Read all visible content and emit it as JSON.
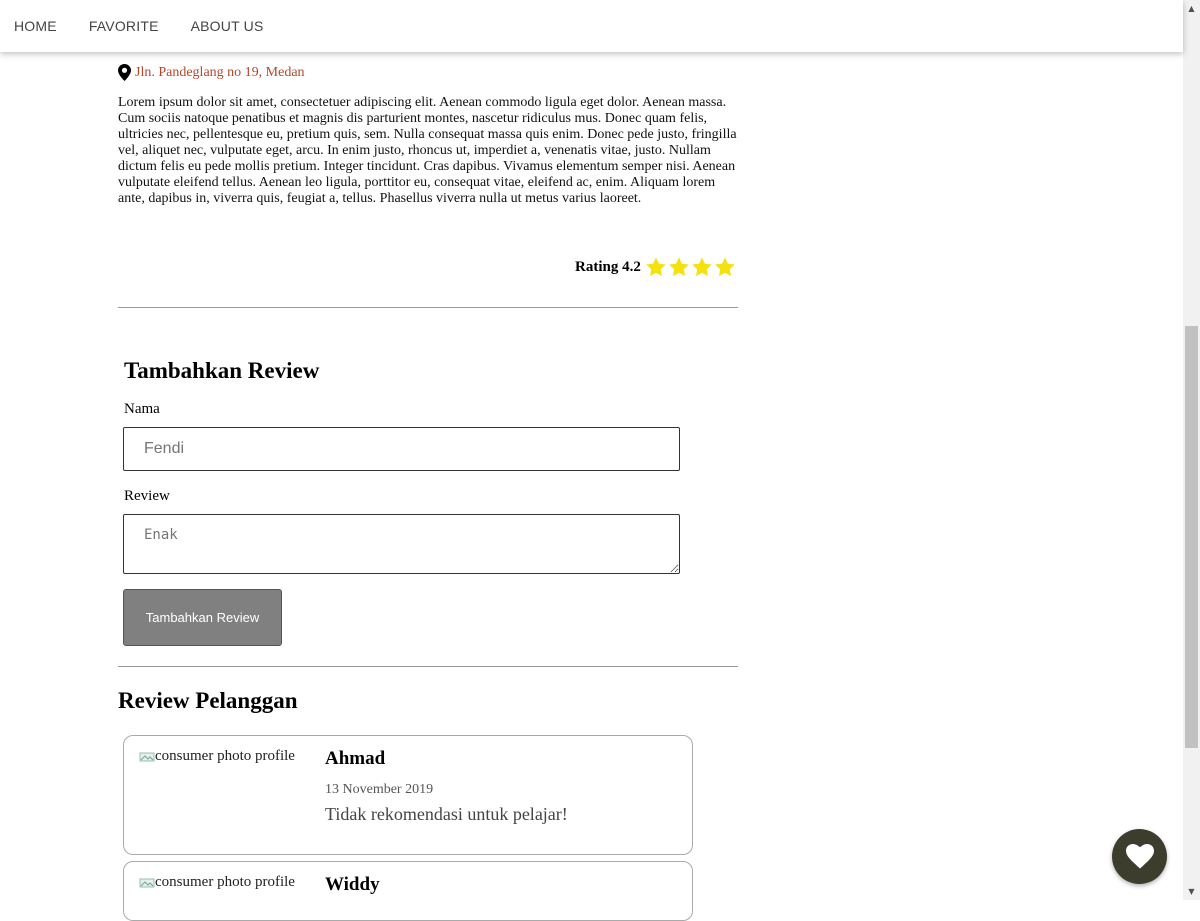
{
  "nav": {
    "items": [
      {
        "label": "HOME"
      },
      {
        "label": "FAVORITE"
      },
      {
        "label": "ABOUT US"
      }
    ]
  },
  "restaurant": {
    "address": "Jln. Pandeglang no 19, Medan",
    "description": "Lorem ipsum dolor sit amet, consectetuer adipiscing elit. Aenean commodo ligula eget dolor. Aenean massa. Cum sociis natoque penatibus et magnis dis parturient montes, nascetur ridiculus mus. Donec quam felis, ultricies nec, pellentesque eu, pretium quis, sem. Nulla consequat massa quis enim. Donec pede justo, fringilla vel, aliquet nec, vulputate eget, arcu. In enim justo, rhoncus ut, imperdiet a, venenatis vitae, justo. Nullam dictum felis eu pede mollis pretium. Integer tincidunt. Cras dapibus. Vivamus elementum semper nisi. Aenean vulputate eleifend tellus. Aenean leo ligula, porttitor eu, consequat vitae, eleifend ac, enim. Aliquam lorem ante, dapibus in, viverra quis, feugiat a, tellus. Phasellus viverra nulla ut metus varius laoreet.",
    "rating_label": "Rating 4.2",
    "rating_value": 4.2,
    "stars_shown": 4,
    "star_color": "#f5e10f"
  },
  "review_form": {
    "title": "Tambahkan Review",
    "name_label": "Nama",
    "name_placeholder": "Fendi",
    "review_label": "Review",
    "review_placeholder": "Enak",
    "submit_label": "Tambahkan Review"
  },
  "reviews": {
    "title": "Review Pelanggan",
    "items": [
      {
        "photo_alt": "consumer photo profile",
        "name": "Ahmad",
        "date": "13 November 2019",
        "text": "Tidak rekomendasi untuk pelajar!"
      },
      {
        "photo_alt": "consumer photo profile",
        "name": "Widdy",
        "date": "",
        "text": ""
      }
    ]
  },
  "fab": {
    "icon": "heart-icon",
    "color": "#3d3d2e"
  }
}
